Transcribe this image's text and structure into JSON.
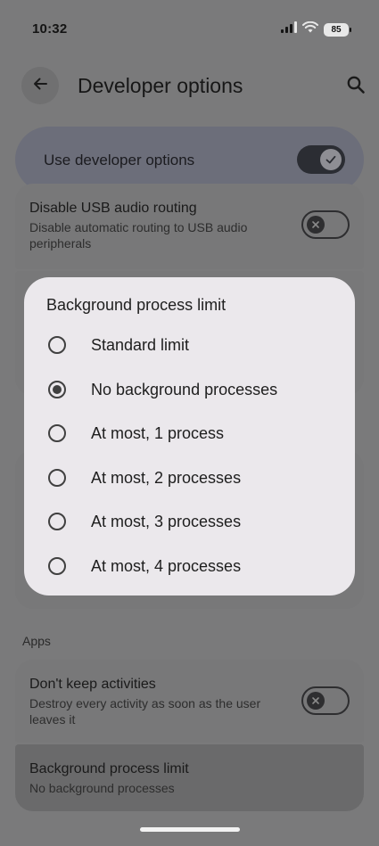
{
  "status_bar": {
    "time": "10:32",
    "battery": "85",
    "icons": [
      "signal-icon",
      "wifi-icon",
      "battery-icon"
    ]
  },
  "app_bar": {
    "title": "Developer options",
    "back_icon": "arrow-back-icon",
    "search_icon": "search-icon"
  },
  "master_switch": {
    "label": "Use developer options",
    "on": true
  },
  "settings": {
    "usb_audio": {
      "title": "Disable USB audio routing",
      "subtitle": "Disable automatic routing to USB audio peripherals",
      "on": false
    },
    "apps_section": "Apps",
    "dont_keep": {
      "title": "Don't keep activities",
      "subtitle": "Destroy every activity as soon as the user leaves it",
      "on": false
    },
    "bg_limit": {
      "title": "Background process limit",
      "subtitle": "No background processes"
    }
  },
  "dialog": {
    "title": "Background process limit",
    "options": [
      {
        "label": "Standard limit",
        "checked": false
      },
      {
        "label": "No background processes",
        "checked": true
      },
      {
        "label": "At most, 1 process",
        "checked": false
      },
      {
        "label": "At most, 2 processes",
        "checked": false
      },
      {
        "label": "At most, 3 processes",
        "checked": false
      },
      {
        "label": "At most, 4 processes",
        "checked": false
      }
    ]
  },
  "colors": {
    "scrim_background": "#7a7a7b",
    "dialog_surface": "#ebe8ec",
    "master_card": "#6c6e7a"
  }
}
